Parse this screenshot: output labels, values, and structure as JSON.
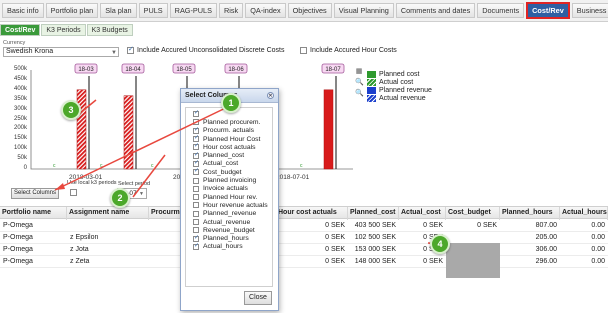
{
  "top_tabs": [
    "Basic info",
    "Portfolio plan",
    "Sla plan",
    "PULS",
    "RAG-PULS",
    "Risk",
    "QA-index",
    "Objectives",
    "Visual Planning",
    "Comments and dates",
    "Documents",
    "Cost/Rev",
    "Business case"
  ],
  "active_top_tab": "Cost/Rev",
  "sub_tabs": [
    "Cost/Rev",
    "K3 Periods",
    "K3 Budgets"
  ],
  "currency": {
    "label": "Currency",
    "value": "Swedish Krona"
  },
  "options": {
    "include_unconsolidated": "Include Accured Unconsolidated Discrete Costs",
    "include_hour_costs": "Include Accured Hour Costs"
  },
  "chart_data": {
    "type": "bar",
    "y_ticks": [
      "500k",
      "450k",
      "400k",
      "350k",
      "300k",
      "250k",
      "200k",
      "150k",
      "100k",
      "50k",
      "0"
    ],
    "ylim": [
      0,
      500000
    ],
    "period_labels": [
      "18-03",
      "18-04",
      "18-05",
      "18-06",
      "18-07"
    ],
    "x_labels": [
      "2018-03-01",
      "2018-05-01",
      "2018-07-01"
    ],
    "series": [
      {
        "name": "Planned cost",
        "color": "#2e9a2e"
      },
      {
        "name": "Actual cost",
        "color": "#2e9a2e"
      },
      {
        "name": "Planned revenue",
        "color": "#1b3fcc"
      },
      {
        "name": "Actual revenue",
        "color": "#1b3fcc"
      }
    ],
    "bars": [
      {
        "period": "18-03",
        "value": 400000
      },
      {
        "period": "18-04",
        "value": 370000
      },
      {
        "period": "18-07",
        "value": 400000
      }
    ]
  },
  "controls": {
    "select_columns_button": "Select Columns",
    "use_local": "Use local k3 periods",
    "period_label": "Select period",
    "period_value": "18-07"
  },
  "dialog": {
    "title": "Select Columns",
    "close_label": "Close",
    "columns": [
      {
        "label": "",
        "checked": true
      },
      {
        "label": "Planned procurem.",
        "checked": false
      },
      {
        "label": "Procurm. actuals",
        "checked": true
      },
      {
        "label": "Planned Hour Cost",
        "checked": true
      },
      {
        "label": "Hour cost actuals",
        "checked": true
      },
      {
        "label": "Planned_cost",
        "checked": true
      },
      {
        "label": "Actual_cost",
        "checked": true
      },
      {
        "label": "Cost_budget",
        "checked": true
      },
      {
        "label": "Planned invoicing",
        "checked": false
      },
      {
        "label": "Invoice actuals",
        "checked": false
      },
      {
        "label": "Planned Hour rev.",
        "checked": false
      },
      {
        "label": "Hour revenue actuals",
        "checked": false
      },
      {
        "label": "Planned_revenue",
        "checked": false
      },
      {
        "label": "Actual_revenue",
        "checked": false
      },
      {
        "label": "Revenue_budget",
        "checked": false
      },
      {
        "label": "Planned_hours",
        "checked": true
      },
      {
        "label": "Actual_hours",
        "checked": true
      }
    ]
  },
  "table": {
    "headers": [
      "Portfolio name",
      "Assignment name",
      "Procurm. a",
      "Hour cost actuals",
      "Planned_cost",
      "Actual_cost",
      "Cost_budget",
      "Planned_hours",
      "Actual_hours"
    ],
    "rows": [
      [
        "P-Omega",
        "",
        "",
        "0 SEK",
        "403 500 SEK",
        "0 SEK",
        "0 SEK",
        "807.00",
        "0.00"
      ],
      [
        "P-Omega",
        "z Epsilon",
        "",
        "0 SEK",
        "102 500 SEK",
        "0 SEK",
        "",
        "205.00",
        "0.00"
      ],
      [
        "P-Omega",
        "z Jota",
        "",
        "0 SEK",
        "153 000 SEK",
        "0 SEK",
        "",
        "306.00",
        "0.00"
      ],
      [
        "P-Omega",
        "z Zeta",
        "",
        "0 SEK",
        "148 000 SEK",
        "0 SEK",
        "",
        "296.00",
        "0.00"
      ]
    ]
  },
  "annotations": [
    "1",
    "2",
    "3",
    "4"
  ]
}
